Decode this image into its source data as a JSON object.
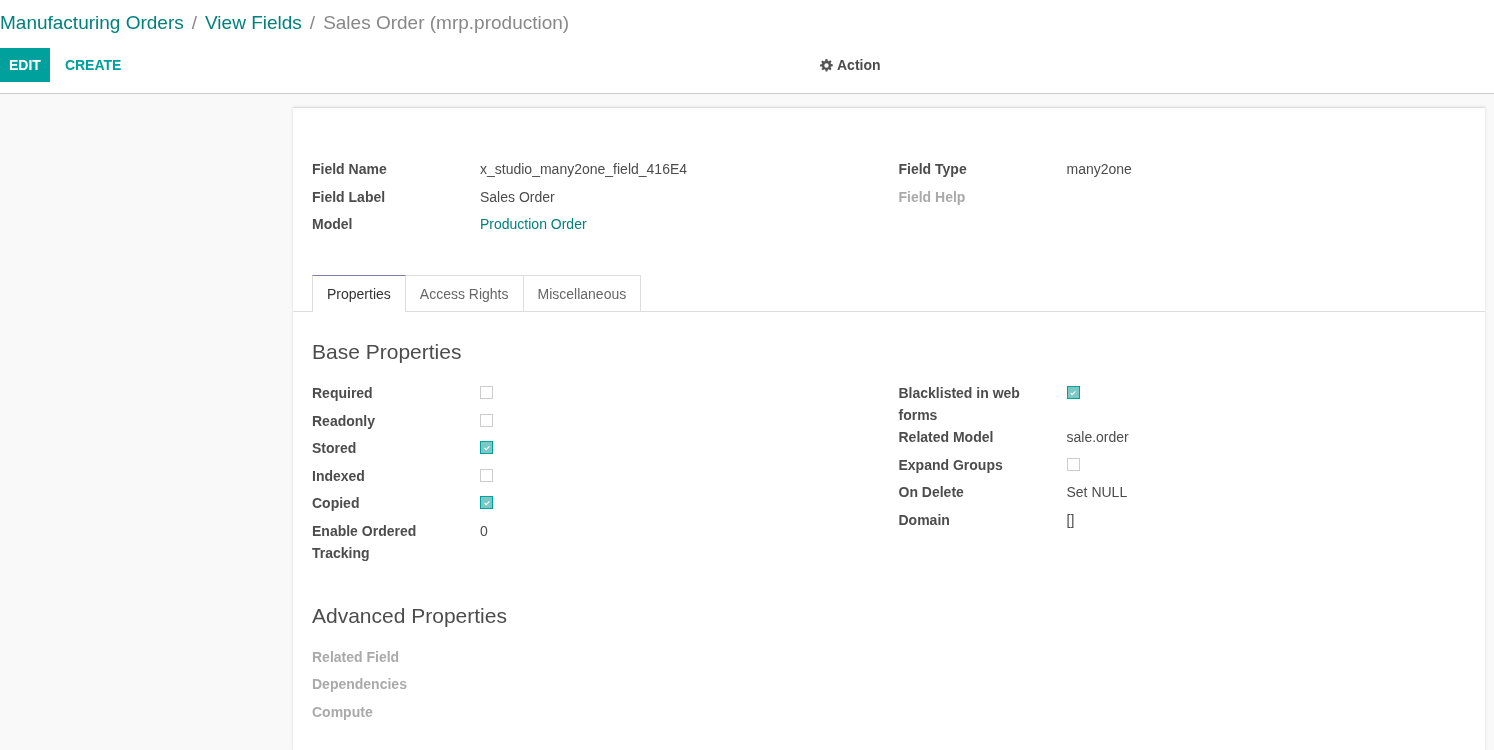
{
  "breadcrumb": [
    {
      "label": "Manufacturing Orders",
      "kind": "link"
    },
    {
      "label": "View Fields",
      "kind": "link"
    },
    {
      "label": "Sales Order (mrp.production)",
      "kind": "current"
    }
  ],
  "separator": "/",
  "buttons": [
    {
      "label": "EDIT",
      "kind": "primary"
    },
    {
      "label": "CREATE",
      "kind": "link"
    }
  ],
  "action": {
    "label": "Action"
  },
  "header_left": [
    {
      "label": "Field Name",
      "kind": "text",
      "value": "x_studio_many2one_field_416E4",
      "disabled": false
    },
    {
      "label": "Field Label",
      "kind": "text",
      "value": "Sales Order",
      "disabled": false
    },
    {
      "label": "Model",
      "kind": "link",
      "value": "Production Order",
      "disabled": false
    }
  ],
  "header_right": [
    {
      "label": "Field Type",
      "kind": "text",
      "value": "many2one",
      "disabled": false
    },
    {
      "label": "Field Help",
      "disabled": true
    }
  ],
  "tabs": [
    {
      "label": "Properties",
      "selected": true
    },
    {
      "label": "Access Rights",
      "selected": false
    },
    {
      "label": "Miscellaneous",
      "selected": false
    }
  ],
  "base_title": "Base Properties",
  "base_left": [
    {
      "label": "Required",
      "kind": "checkbox",
      "checked": false,
      "disabled": false
    },
    {
      "label": "Readonly",
      "kind": "checkbox",
      "checked": false,
      "disabled": false
    },
    {
      "label": "Stored",
      "kind": "checkbox",
      "checked": true,
      "disabled": false
    },
    {
      "label": "Indexed",
      "kind": "checkbox",
      "checked": false,
      "disabled": false
    },
    {
      "label": "Copied",
      "kind": "checkbox",
      "checked": true,
      "disabled": false
    },
    {
      "label": "Enable Ordered Tracking",
      "kind": "text",
      "value": "0",
      "disabled": false
    }
  ],
  "base_right": [
    {
      "label": "Blacklisted in web forms",
      "kind": "checkbox",
      "checked": true,
      "disabled": false
    },
    {
      "label": "Related Model",
      "kind": "text",
      "value": "sale.order",
      "disabled": false
    },
    {
      "label": "Expand Groups",
      "kind": "checkbox",
      "checked": false,
      "disabled": false
    },
    {
      "label": "On Delete",
      "kind": "text",
      "value": "Set NULL",
      "disabled": false
    },
    {
      "label": "Domain",
      "kind": "text",
      "value": "[]",
      "disabled": false
    }
  ],
  "advanced_title": "Advanced Properties",
  "advanced_left": [
    {
      "label": "Related Field",
      "disabled": true
    },
    {
      "label": "Dependencies",
      "disabled": true
    },
    {
      "label": "Compute",
      "disabled": true
    }
  ]
}
